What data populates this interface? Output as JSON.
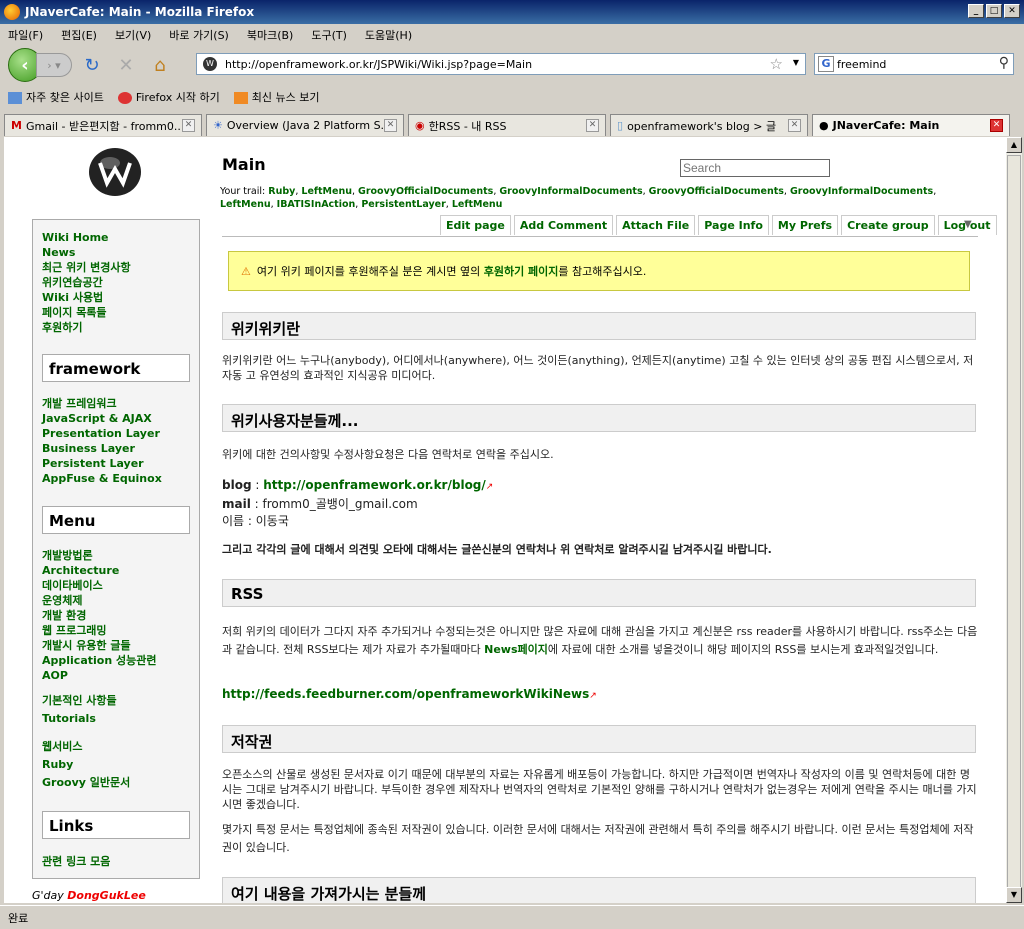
{
  "window": {
    "title": "JNaverCafe: Main - Mozilla Firefox"
  },
  "menu": [
    "파일(F)",
    "편집(E)",
    "보기(V)",
    "바로 가기(S)",
    "북마크(B)",
    "도구(T)",
    "도움말(H)"
  ],
  "url": "http://openframework.or.kr/JSPWiki/Wiki.jsp?page=Main",
  "search_engine_text": "freemind",
  "bookmarks": [
    "자주 찾은 사이트",
    "Firefox 시작 하기",
    "최신 뉴스 보기"
  ],
  "tabs": [
    "Gmail - 받은편지함 - fromm0...",
    "Overview (Java 2 Platform S...",
    "한RSS - 내 RSS",
    "openframework's blog > 글",
    "JNaverCafe: Main"
  ],
  "status": "완료",
  "page": {
    "title": "Main",
    "search_placeholder": "Search",
    "trail_label": "Your trail:",
    "trail": [
      "Ruby",
      "LeftMenu",
      "GroovyOfficialDocuments",
      "GroovyInformalDocuments",
      "GroovyOfficialDocuments",
      "GroovyInformalDocuments",
      "LeftMenu",
      "IBATISInAction",
      "PersistentLayer",
      "LeftMenu"
    ],
    "actions": [
      "Edit page",
      "Add Comment",
      "Attach File",
      "Page Info",
      "My Prefs",
      "Create group",
      "Log out"
    ],
    "notice_pre": "여기 위키 페이지를 후원해주실 분은 계시면 옆의 ",
    "notice_link": "후원하기 페이지",
    "notice_post": "를 참고해주십시오.",
    "sections": {
      "s1_title": "위키위키란",
      "s1_text": "위키위키란 어느 누구나(anybody), 어디에서나(anywhere), 어느 것이든(anything), 언제든지(anytime) 고칠 수 있는 인터넷 상의 공동 편집 시스템으로서, 저 자동 고 유연성의 효과적인 지식공유 미디어다.",
      "s2_title": "위키사용자분들께...",
      "s2_text": "위키에 대한 건의사항및 수정사항요청은 다음 연락처로 연락을 주십시오.",
      "blog_label": "blog",
      "blog_url": "http://openframework.or.kr/blog/",
      "mail_label": "mail",
      "mail_value": "fromm0_골뱅이_gmail.com",
      "name_label": "이름",
      "name_value": "이동국",
      "s2_bold": "그리고 각각의 글에 대해서 의견및 오타에 대해서는 글쓴신분의 연락처나 위 연락처로 알려주시길 남겨주시길 바랍니다.",
      "s3_title": "RSS",
      "s3_text_pre": "저희 위키의 데이터가 그다지 자주 추가되거나 수정되는것은 아니지만 많은 자료에 대해 관심을 가지고 계신분은 rss reader를 사용하시기 바랍니다. rss주소는 다음과 같습니다. 전체 RSS보다는 제가 자료가 추가될때마다 ",
      "s3_link": "News페이지",
      "s3_text_post": "에 자료에 대한 소개를 넣을것이니 해당 페이지의 RSS를 보시는게 효과적일것입니다.",
      "rss_url": "http://feeds.feedburner.com/openframeworkWikiNews",
      "s4_title": "저작권",
      "s4_text1": "오픈소스의 산물로 생성된 문서자료 이기 때문에 대부분의 자료는 자유롭게 배포등이 가능합니다. 하지만 가급적이면 번역자나 작성자의 이름 및 연락처등에 대한 명시는 그대로 남겨주시기 바랍니다. 부득이한 경우엔 제작자나 번역자의 연락처로 기본적인 양해를 구하시거나 연락처가 없는경우는 저에게 연락을 주시는 매너를 가지시면 좋겠습니다.",
      "s4_text2": "몇가지 특정 문서는 특정업체에 종속된 저작권이 있습니다. 이러한 문서에 대해서는 저작권에 관련해서 특히 주의를 해주시기 바랍니다. 이런 문서는 특정업체에 저작권이 있습니다.",
      "s5_title": "여기 내용을 가져가시는 분들께"
    }
  },
  "sidebar": {
    "top_links": [
      "Wiki Home",
      "News",
      "최근 위키 변경사항",
      "위키연습공간",
      "Wiki 사용법",
      "페이지 목록들",
      "후원하기"
    ],
    "box1": "framework",
    "framework_links": [
      "개발 프레임워크",
      "JavaScript & AJAX",
      "Presentation Layer",
      "Business Layer",
      "Persistent Layer",
      "AppFuse & Equinox"
    ],
    "box2": "Menu",
    "menu_links": [
      "개발방법론",
      "Architecture",
      "데이타베이스",
      "운영체제",
      "개발 환경",
      "웹 프로그래밍",
      "개발시 유용한 글들",
      "Application 성능관련",
      "AOP"
    ],
    "menu_links2": [
      "기본적인 사항들",
      "Tutorials"
    ],
    "menu_links3": [
      "웹서비스",
      "Ruby",
      "Groovy 일반문서"
    ],
    "box3": "Links",
    "links_links": [
      "관련 링크 모음"
    ],
    "gday_label": "G'day",
    "gday_name": "DongGukLee"
  }
}
